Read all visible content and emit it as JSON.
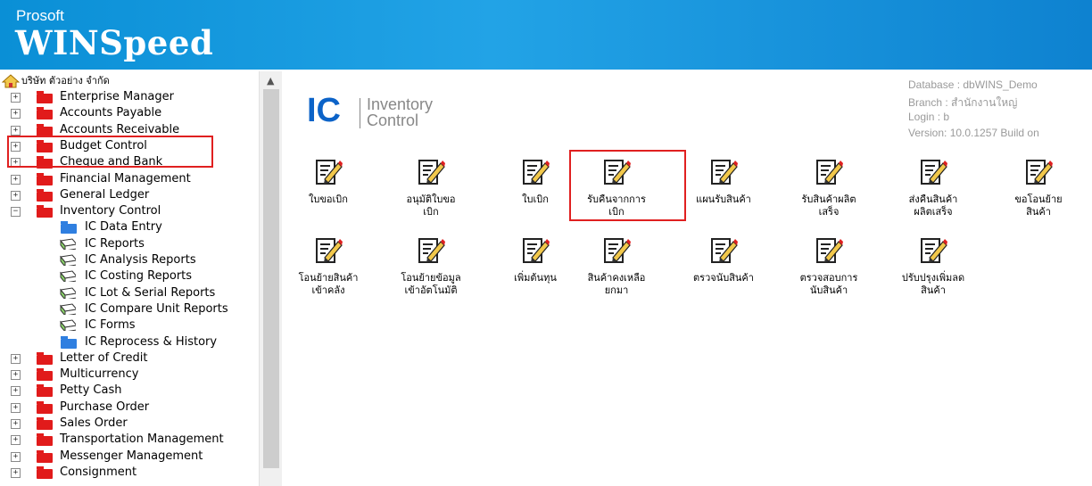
{
  "header": {
    "brand_top": "Prosoft",
    "brand_main": "WINSpeed"
  },
  "tree": {
    "root_label": "บริษัท ตัวอย่าง จำกัด",
    "items": [
      {
        "label": "Enterprise Manager",
        "type": "module"
      },
      {
        "label": "Accounts Payable",
        "type": "module"
      },
      {
        "label": "Accounts Receivable",
        "type": "module"
      },
      {
        "label": "Budget Control",
        "type": "module"
      },
      {
        "label": "Cheque and Bank",
        "type": "module"
      },
      {
        "label": "Financial Management",
        "type": "module"
      },
      {
        "label": "General Ledger",
        "type": "module"
      },
      {
        "label": "Inventory Control",
        "type": "module",
        "expanded": true
      },
      {
        "label": "IC Data Entry",
        "type": "folder",
        "selected": true
      },
      {
        "label": "IC Reports",
        "type": "report"
      },
      {
        "label": "IC Analysis Reports",
        "type": "report"
      },
      {
        "label": "IC Costing Reports",
        "type": "report"
      },
      {
        "label": "IC Lot & Serial Reports",
        "type": "report"
      },
      {
        "label": "IC Compare Unit Reports",
        "type": "report"
      },
      {
        "label": "IC Forms",
        "type": "report"
      },
      {
        "label": "IC Reprocess & History",
        "type": "folder"
      },
      {
        "label": "Letter of Credit",
        "type": "module"
      },
      {
        "label": "Multicurrency",
        "type": "module"
      },
      {
        "label": "Petty Cash",
        "type": "module"
      },
      {
        "label": "Purchase Order",
        "type": "module"
      },
      {
        "label": "Sales Order",
        "type": "module"
      },
      {
        "label": "Transportation Management",
        "type": "module"
      },
      {
        "label": "Messenger Management",
        "type": "module"
      },
      {
        "label": "Consignment",
        "type": "module"
      }
    ]
  },
  "module_header": {
    "code": "IC",
    "title_line1": "Inventory",
    "title_line2": "Control"
  },
  "info": {
    "database": "Database :  dbWINS_Demo",
    "branch": "Branch :    สำนักงานใหญ่",
    "login": "Login :       b",
    "version": "Version: 10.0.1257  Build on"
  },
  "tiles": [
    {
      "label": "ใบขอเบิก"
    },
    {
      "label": "อนุมัติใบขอ\nเบิก"
    },
    {
      "label": "ใบเบิก"
    },
    {
      "label": "รับคืนจากการ\nเบิก",
      "highlighted": true
    },
    {
      "label": "แผนรับสินค้า"
    },
    {
      "label": "รับสินค้าผลิต\nเสร็จ"
    },
    {
      "label": "ส่งคืนสินค้า\nผลิตเสร็จ"
    },
    {
      "label": "ขอโอนย้าย\nสินค้า"
    },
    {
      "label": "โอนย้ายสินค้า\nเข้าคลัง"
    },
    {
      "label": "โอนย้ายข้อมูล\nเข้าอัตโนมัติ"
    },
    {
      "label": "เพิ่มต้นทุน"
    },
    {
      "label": "สินค้าคงเหลือ\nยกมา"
    },
    {
      "label": "ตรวจนับสินค้า"
    },
    {
      "label": "ตรวจสอบการ\nนับสินค้า"
    },
    {
      "label": "ปรับปรุงเพิ่มลด\nสินค้า"
    }
  ],
  "colors": {
    "header_blue": "#1a9be0",
    "highlight_red": "#e02020",
    "ic_blue": "#0c63c8"
  },
  "icons": {
    "tile_icon": "edit-document-icon",
    "root_icon": "home-icon",
    "module_icon": "red-folder-icon"
  }
}
